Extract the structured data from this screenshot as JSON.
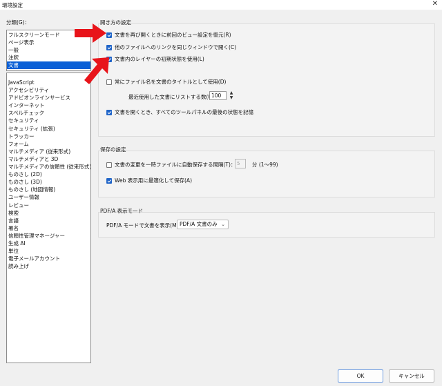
{
  "window": {
    "title": "環境設定",
    "close_label": "✕"
  },
  "categories": {
    "label": "分類(G)：",
    "top_items": [
      {
        "label": "フルスクリーンモード"
      },
      {
        "label": "ページ表示"
      },
      {
        "label": "一般"
      },
      {
        "label": "注釈"
      },
      {
        "label": "文書",
        "selected": true
      }
    ],
    "items": [
      {
        "label": "JavaScript"
      },
      {
        "label": "アクセシビリティ"
      },
      {
        "label": "アドビオンラインサービス"
      },
      {
        "label": "インターネット"
      },
      {
        "label": "スペルチェック"
      },
      {
        "label": "セキュリティ"
      },
      {
        "label": "セキュリティ (拡張)"
      },
      {
        "label": "トラッカー"
      },
      {
        "label": "フォーム"
      },
      {
        "label": "マルチメディア (従来形式)"
      },
      {
        "label": "マルチメディアと 3D"
      },
      {
        "label": "マルチメディアの信頼性 (従来形式)"
      },
      {
        "label": "ものさし (2D)"
      },
      {
        "label": "ものさし (3D)"
      },
      {
        "label": "ものさし (地図情報)"
      },
      {
        "label": "ユーザー情報"
      },
      {
        "label": "レビュー"
      },
      {
        "label": "検索"
      },
      {
        "label": "言語"
      },
      {
        "label": "署名"
      },
      {
        "label": "信頼性管理マネージャー"
      },
      {
        "label": "生成 AI"
      },
      {
        "label": "単位"
      },
      {
        "label": "電子メールアカウント"
      },
      {
        "label": "読み上げ"
      }
    ]
  },
  "open_settings": {
    "title": "開き方の設定",
    "restore_view": {
      "label": "文書を再び開くときに前回のビュー設定を復元(R)",
      "checked": true
    },
    "same_window": {
      "label": "他のファイルへのリンクを同じウィンドウで開く(C)",
      "checked": true
    },
    "layer_state": {
      "label": "文書内のレイヤーの初期状態を使用(L)",
      "checked": true
    },
    "filename_title": {
      "label": "常にファイル名を文書のタイトルとして使用(D)",
      "checked": false
    },
    "recent_label": "最近使用した文書にリストする数(U)：",
    "recent_value": "100",
    "remember_panels": {
      "label": "文書を開くとき、すべてのツールパネルの最後の状態を記憶",
      "checked": true
    }
  },
  "save_settings": {
    "title": "保存の設定",
    "autosave": {
      "label": "文書の変更を一時ファイルに自動保存する間隔(T)：",
      "checked": false
    },
    "autosave_value": "5",
    "autosave_unit": "分 (1〜99)",
    "web_optimize": {
      "label": "Web 表示用に最適化して保存(A)",
      "checked": true
    }
  },
  "pdfa": {
    "title": "PDF/A 表示モード",
    "label": "PDF/A モードで文書を表示(M)：",
    "selected": "PDF/A 文書のみ"
  },
  "buttons": {
    "ok": "OK",
    "cancel": "キャンセル"
  },
  "colors": {
    "selection": "#0a5fd6",
    "checkbox": "#1f64c8",
    "arrow": "#e8141a"
  }
}
